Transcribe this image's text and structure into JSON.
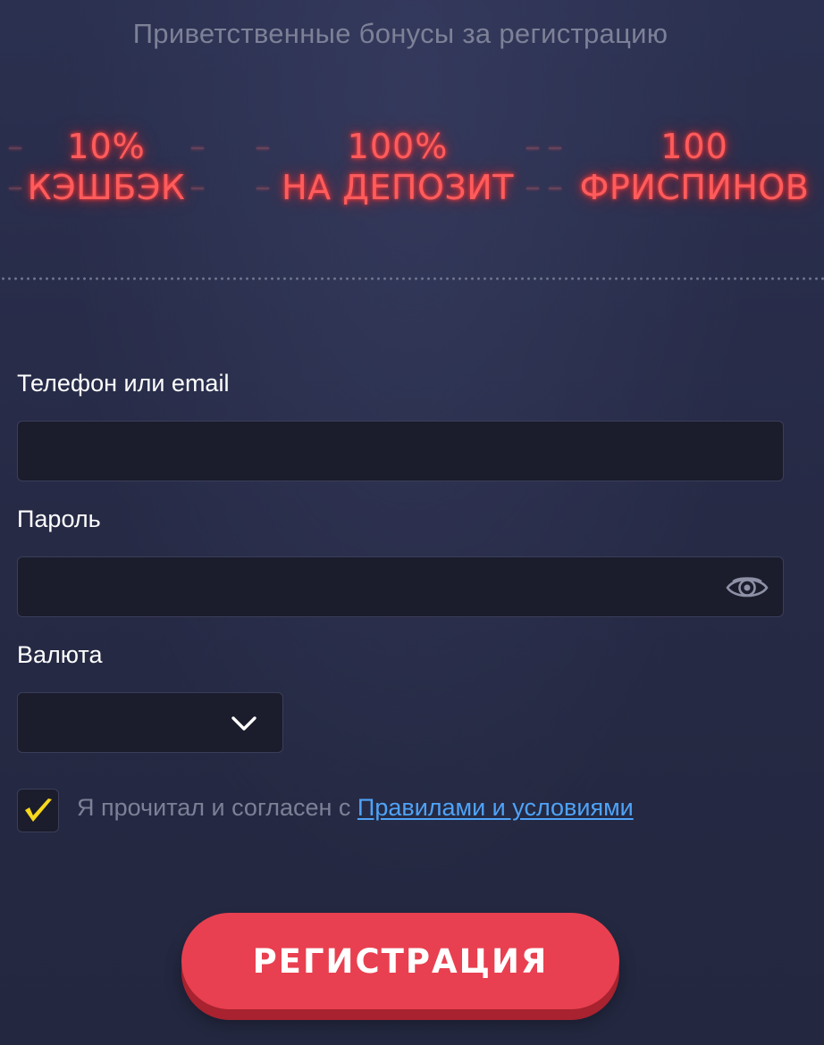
{
  "headline": "Приветственные бонусы за регистрацию",
  "bonuses": [
    {
      "line1": "10%",
      "line2": "КЭШБЭК"
    },
    {
      "line1": "100%",
      "line2": "НА ДЕПОЗИТ"
    },
    {
      "line1": "100",
      "line2": "ФРИСПИНОВ"
    }
  ],
  "form": {
    "phone_label": "Телефон или email",
    "phone_value": "",
    "password_label": "Пароль",
    "password_value": "",
    "currency_label": "Валюта",
    "currency_value": "",
    "agree_checked": true,
    "agree_text": "Я прочитал и согласен с ",
    "agree_link": "Правилами и условиями",
    "submit_label": "РЕГИСТРАЦИЯ"
  },
  "colors": {
    "background": "#272b47",
    "neon": "#ff5c5c",
    "accent_button": "#e84050",
    "link": "#4fa3f7",
    "checkmark": "#f7d81c"
  },
  "icons": {
    "password_toggle": "eye-icon",
    "currency_dropdown": "chevron-down-icon",
    "checkbox_mark": "checkmark-icon"
  }
}
